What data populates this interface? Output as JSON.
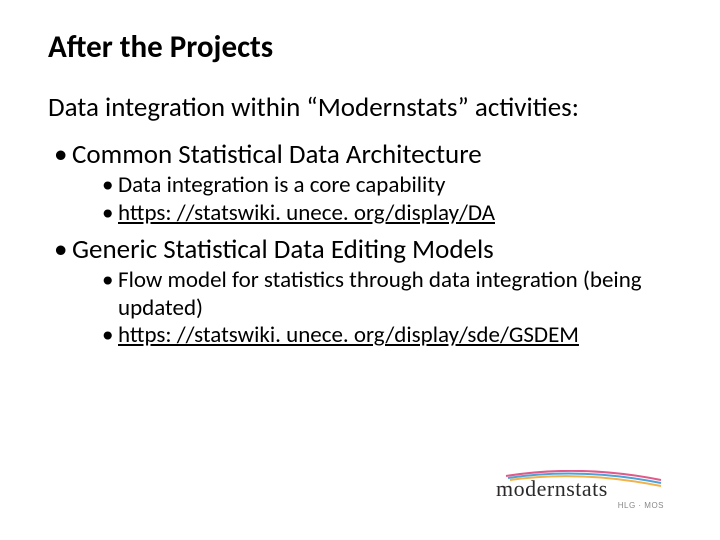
{
  "title": "After the Projects",
  "subtitle": "Data integration within “Modernstats” activities:",
  "bullets": [
    {
      "label": "Common Statistical Data Architecture",
      "sub": [
        {
          "label": "Data integration is a core capability",
          "link": false
        },
        {
          "label": "https: //statswiki. unece. org/display/DA",
          "link": true
        }
      ]
    },
    {
      "label": "Generic Statistical Data Editing Models",
      "sub": [
        {
          "label": "Flow model for statistics through data integration (being updated)",
          "link": false
        },
        {
          "label": "https: //statswiki. unece. org/display/sde/GSDEM",
          "link": true
        }
      ]
    }
  ],
  "logo": {
    "word": "modernstats",
    "sub": "HLG · MOS"
  }
}
